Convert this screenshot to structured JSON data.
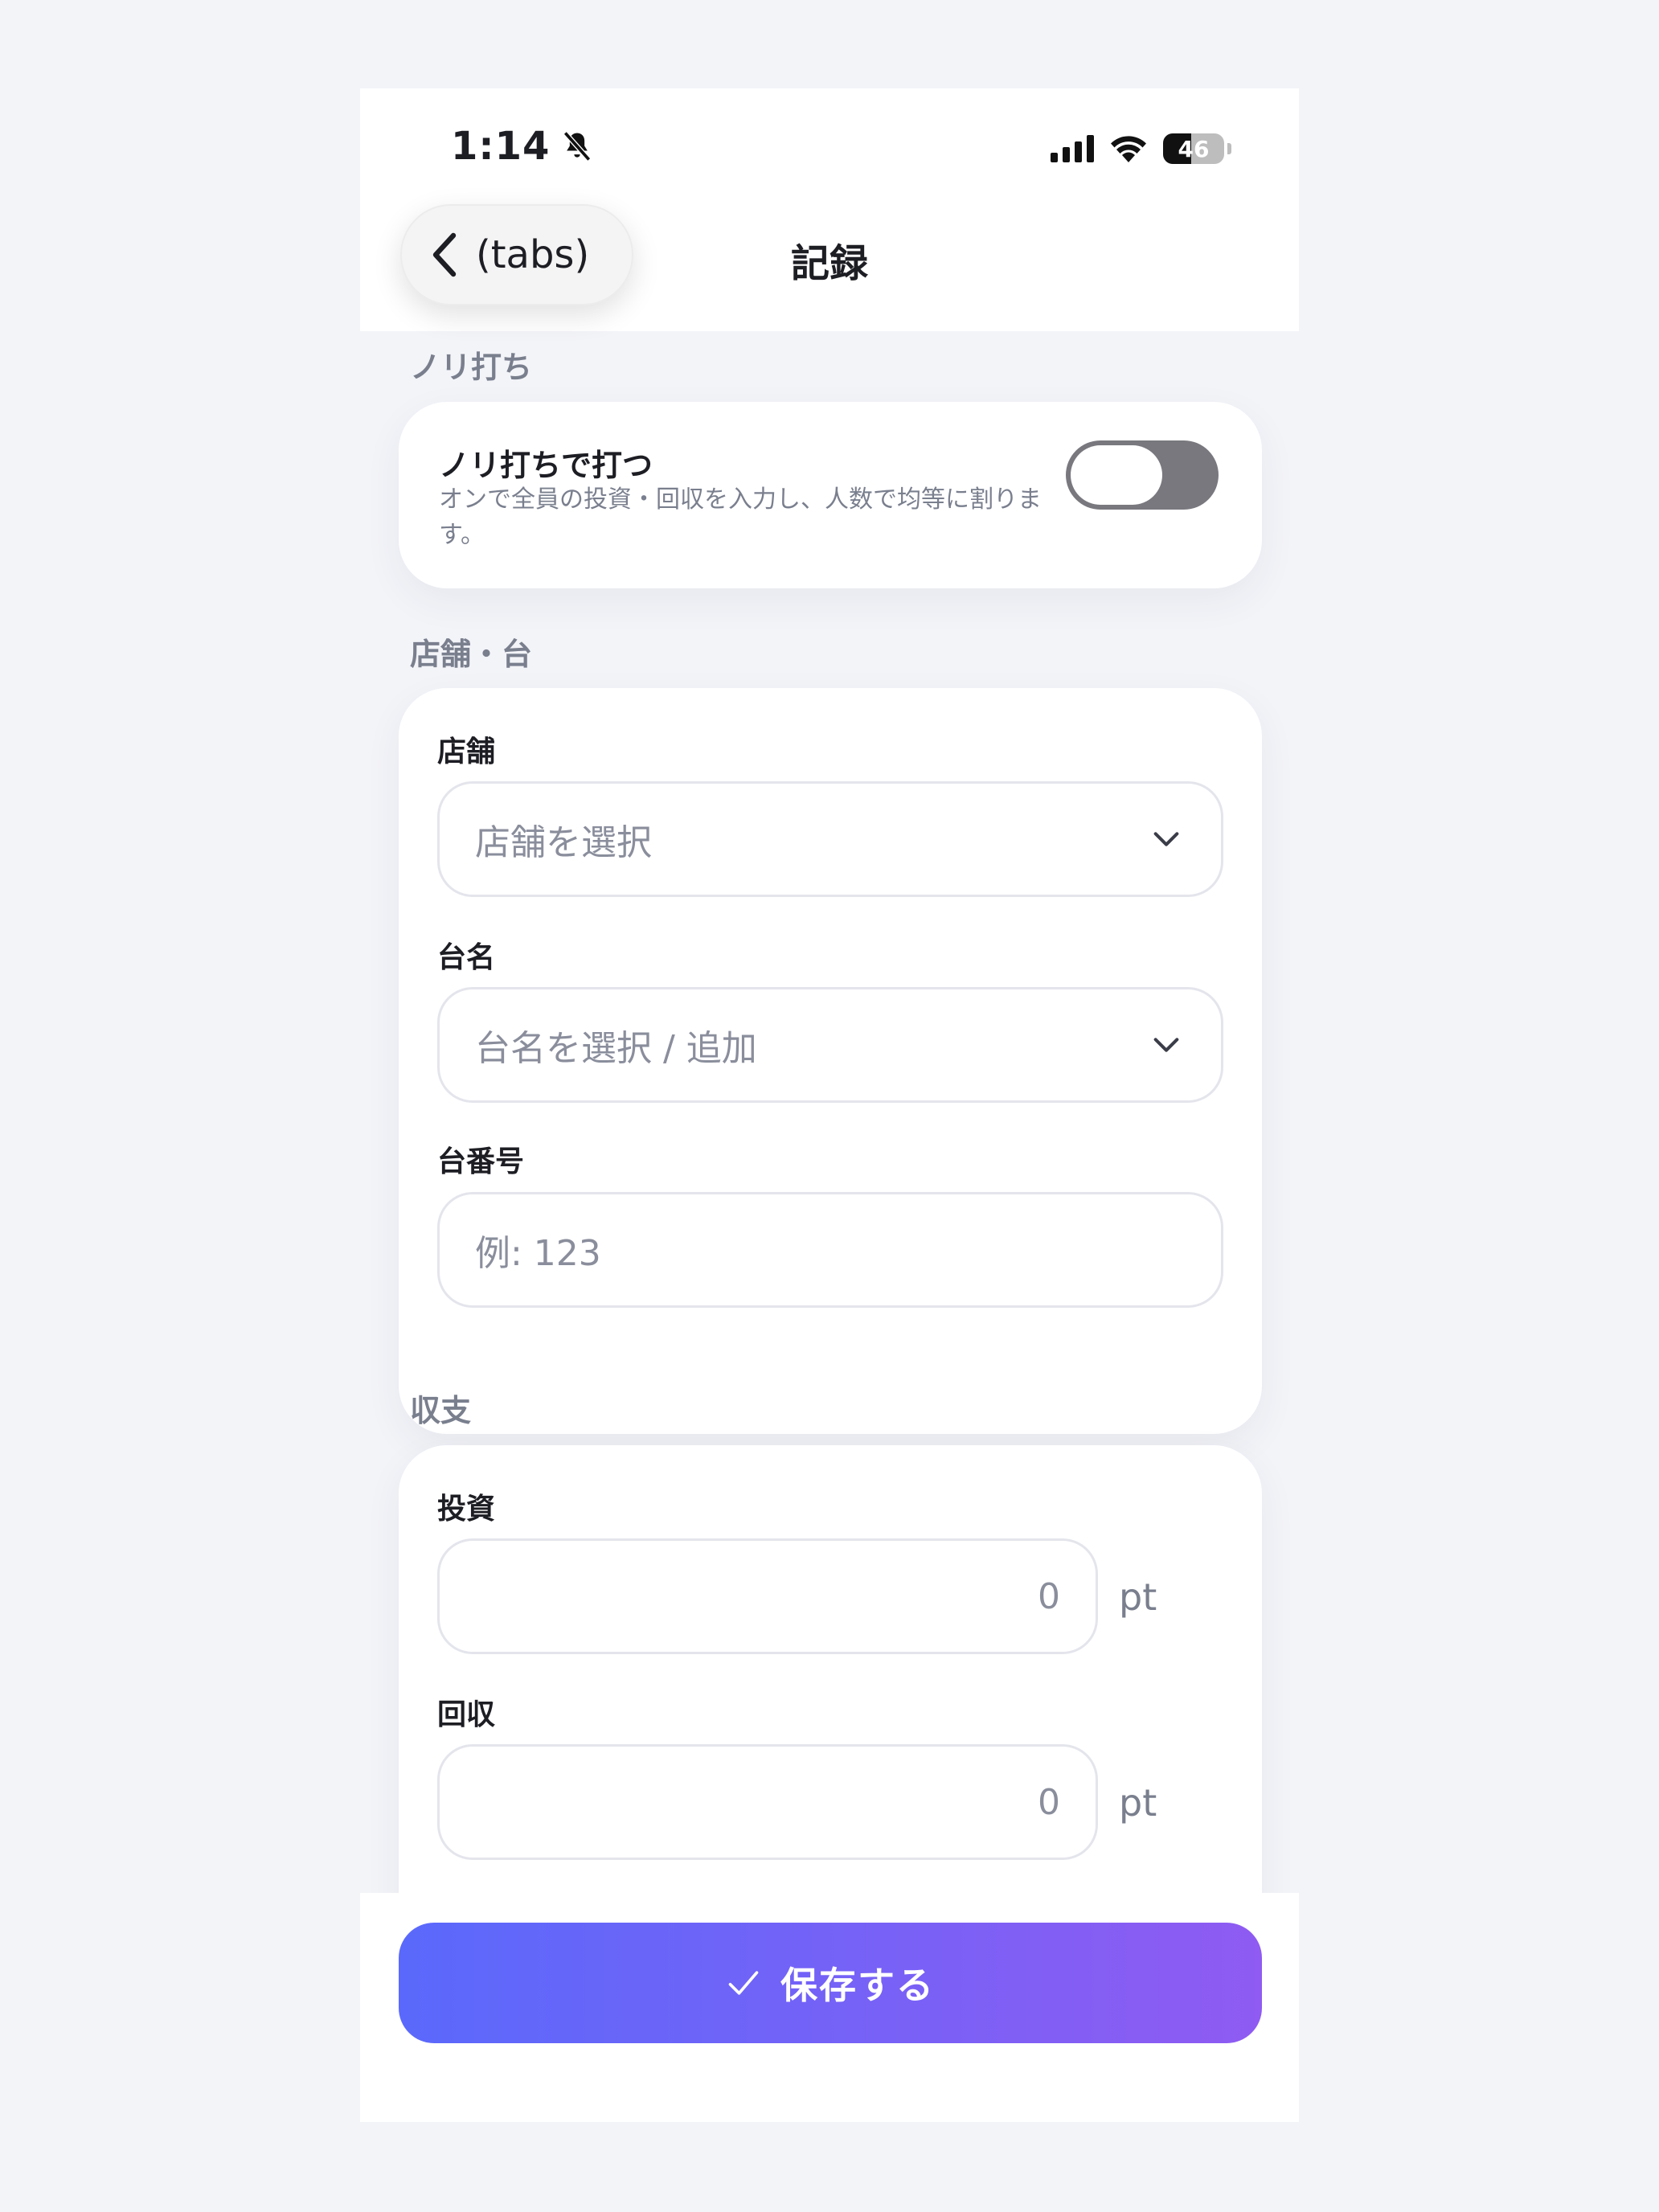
{
  "status_bar": {
    "time": "1:14",
    "battery": "46",
    "battery_level": 0.46
  },
  "nav": {
    "back_label": "(tabs)",
    "title": "記録"
  },
  "sections": {
    "group_play": {
      "label": "ノリ打ち",
      "toggle_title": "ノリ打ちで打つ",
      "toggle_desc": "オンで全員の投資・回収を入力し、人数で均等に割ります。",
      "toggle_on": false
    },
    "store": {
      "label": "店舗・台",
      "store_label": "店舗",
      "store_placeholder": "店舗を選択",
      "machine_label": "台名",
      "machine_placeholder": "台名を選択 / 追加",
      "number_label": "台番号",
      "number_placeholder": "例: 123"
    },
    "balance": {
      "label": "収支",
      "invest_label": "投資",
      "invest_value": "0",
      "invest_unit": "pt",
      "return_label": "回収",
      "return_value": "0",
      "return_unit": "pt"
    }
  },
  "footer": {
    "save_label": "保存する"
  },
  "colors": {
    "accent_start": "#5a69fb",
    "accent_end": "#8f5bf2",
    "switch_off": "#78787e"
  }
}
